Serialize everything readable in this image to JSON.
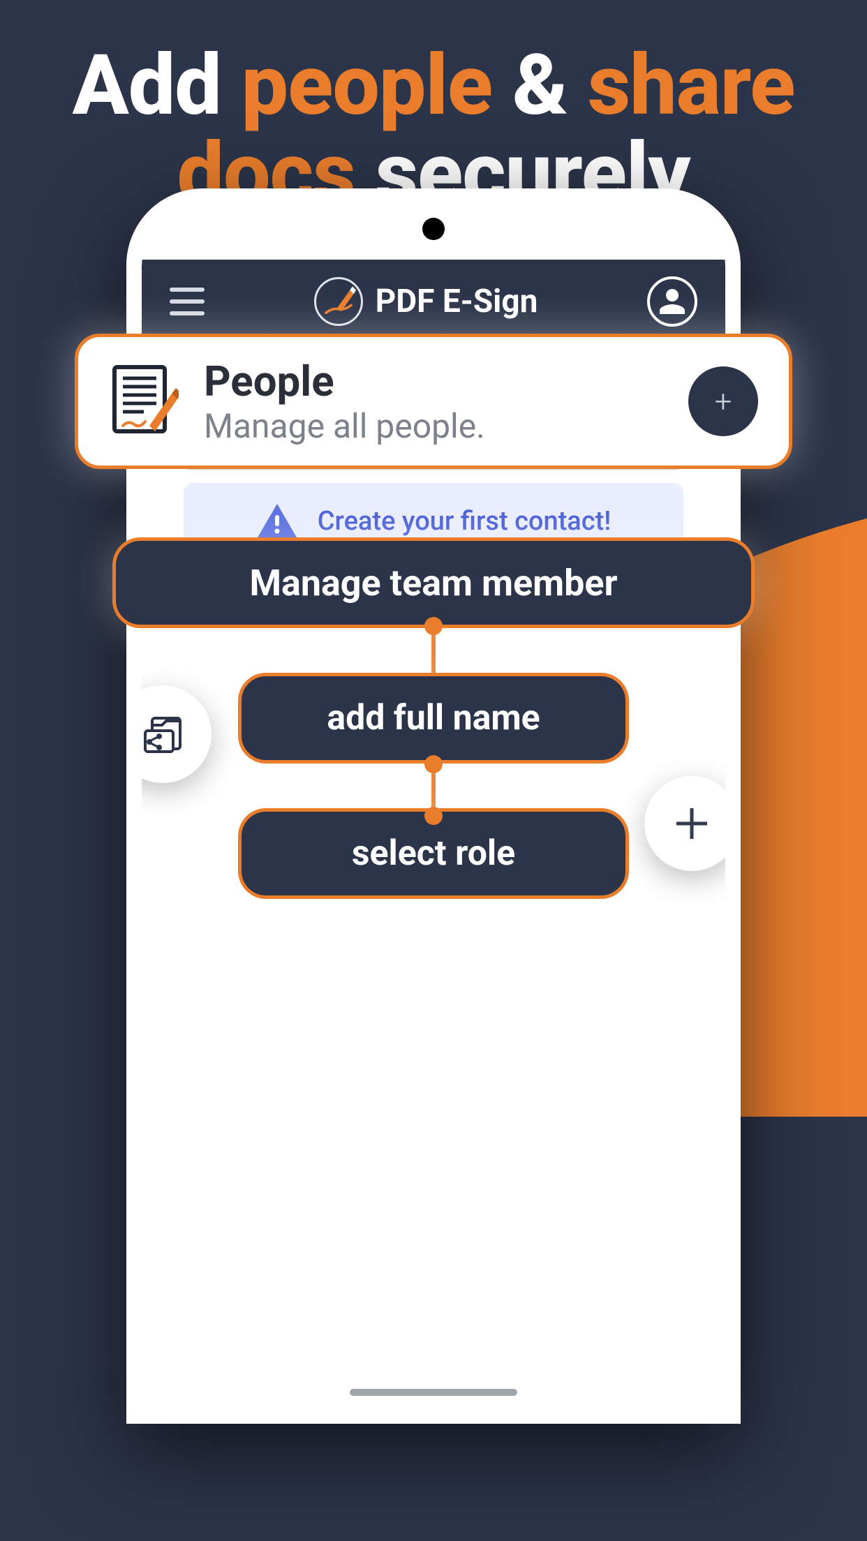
{
  "headline": {
    "w1": "Add ",
    "a1": "people",
    "w2": " & ",
    "a2": "share docs",
    "w3": " securely"
  },
  "app": {
    "title": "PDF E-Sign"
  },
  "people_card": {
    "title": "People",
    "subtitle": "Manage all people.",
    "add_label": "+"
  },
  "info_banner": {
    "text": "Create your first contact!"
  },
  "pills": {
    "manage": "Manage team member",
    "fullname": "add full name",
    "role": "select role"
  },
  "colors": {
    "accent": "#e97d2c",
    "dark": "#2b3449"
  }
}
